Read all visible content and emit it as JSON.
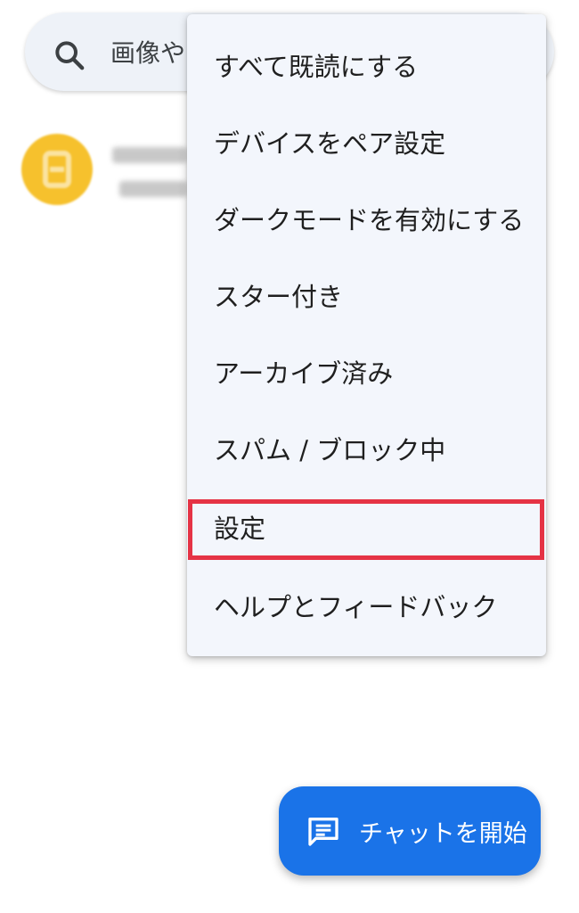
{
  "search": {
    "text": "画像や",
    "icon": "search-icon"
  },
  "menu": {
    "items": [
      {
        "label": "すべて既読にする"
      },
      {
        "label": "デバイスをペア設定"
      },
      {
        "label": "ダークモードを有効にする"
      },
      {
        "label": "スター付き"
      },
      {
        "label": "アーカイブ済み"
      },
      {
        "label": "スパム / ブロック中"
      },
      {
        "label": "設定"
      },
      {
        "label": "ヘルプとフィードバック"
      }
    ],
    "highlighted_index": 6,
    "highlight_color": "#e53345"
  },
  "fab": {
    "label": "チャットを開始",
    "icon": "chat-message-icon",
    "color": "#1a73e8"
  },
  "colors": {
    "menu_background": "#f3f6fc",
    "search_background": "#eef2f8",
    "avatar": "#f6c12d"
  }
}
